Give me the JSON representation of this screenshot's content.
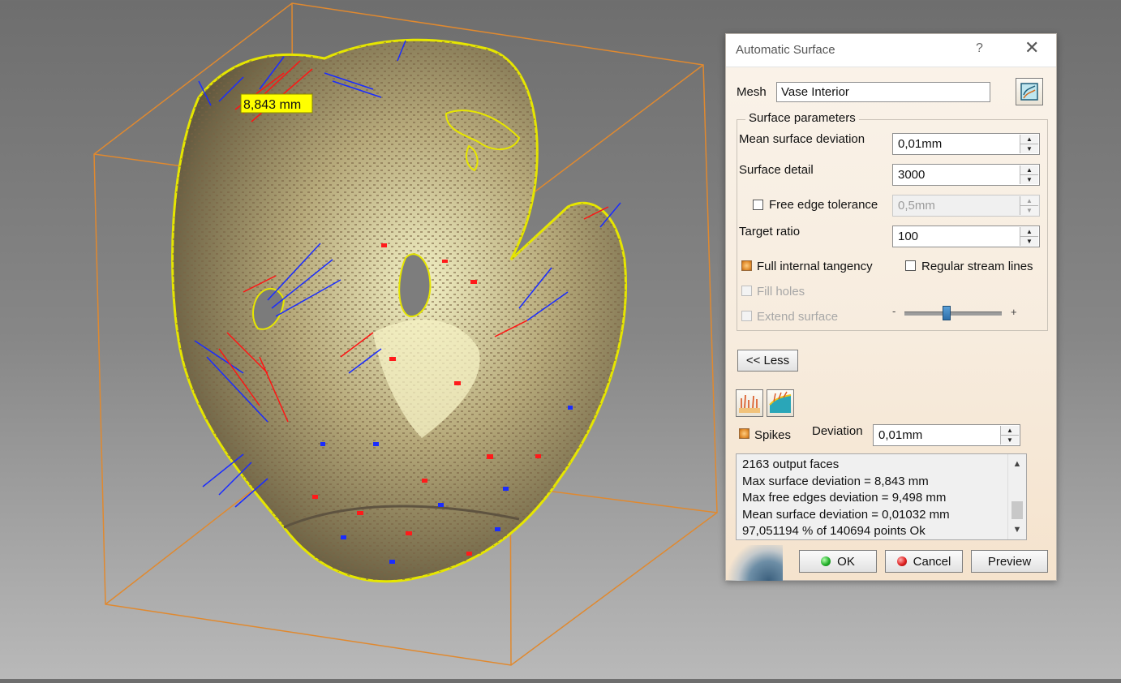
{
  "viewport": {
    "measure_label": "8,843 mm"
  },
  "dialog": {
    "title": "Automatic Surface",
    "help_glyph": "?",
    "close_glyph": "✕",
    "mesh_label": "Mesh",
    "mesh_value": "Vase Interior",
    "group_title": "Surface parameters",
    "mean_dev_label": "Mean surface deviation",
    "mean_dev_value": "0,01mm",
    "surface_detail_label": "Surface detail",
    "surface_detail_value": "3000",
    "free_edge_label": "Free edge tolerance",
    "free_edge_value": "0,5mm",
    "target_ratio_label": "Target ratio",
    "target_ratio_value": "100",
    "full_tangency_label": "Full internal tangency",
    "regular_stream_label": "Regular stream lines",
    "fill_holes_label": "Fill holes",
    "extend_surface_label": "Extend surface",
    "slider_minus": "-",
    "slider_plus": "+",
    "less_button": "<< Less",
    "spikes_label": "Spikes",
    "deviation_label": "Deviation",
    "deviation_value": "0,01mm",
    "output_lines": [
      "2163 output faces",
      "Max surface deviation = 8,843 mm",
      "Max free edges deviation = 9,498 mm",
      "Mean surface deviation = 0,01032 mm",
      "97,051194 % of 140694 points Ok"
    ],
    "ok_label": "OK",
    "cancel_label": "Cancel",
    "preview_label": "Preview"
  }
}
